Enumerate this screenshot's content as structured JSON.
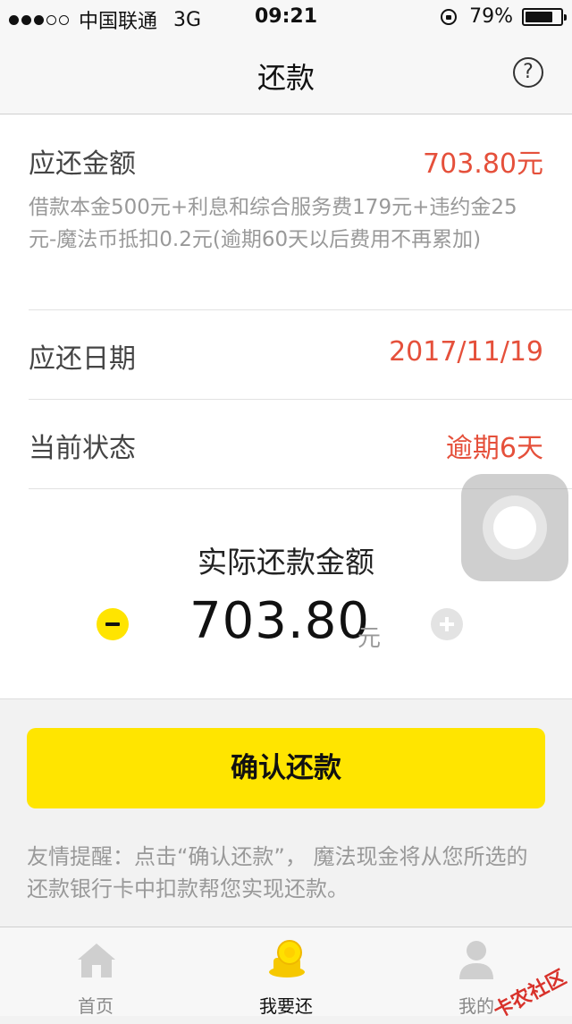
{
  "status_bar": {
    "carrier": "中国联通",
    "network": "3G",
    "time": "09:21",
    "battery_percent": "79%",
    "signal_bars_filled": 3,
    "signal_bars_total": 5
  },
  "nav": {
    "title": "还款",
    "help_icon": "?"
  },
  "repayment": {
    "amount_due_label": "应还金额",
    "amount_due_value": "703.80元",
    "amount_detail": "借款本金500元+利息和综合服务费179元+违约金25元-魔法币抵扣0.2元(逾期60天以后费用不再累加)",
    "due_date_label": "应还日期",
    "due_date_value": "2017/11/19",
    "status_label": "当前状态",
    "status_value": "逾期6天",
    "actual_amount_title": "实际还款金额",
    "actual_amount": "703.80",
    "currency_unit": "元"
  },
  "confirm_button": "确认还款",
  "reminder": "友情提醒：点击“确认还款”， 魔法现金将从您所选的还款银行卡中扣款帮您实现还款。",
  "tabs": [
    {
      "label": "首页",
      "icon": "home-icon",
      "active": false
    },
    {
      "label": "我要还",
      "icon": "coin-icon",
      "active": true
    },
    {
      "label": "我的",
      "icon": "user-icon",
      "active": false
    }
  ],
  "watermark": "卡农社区",
  "colors": {
    "accent_yellow": "#ffe500",
    "overdue_red": "#e5503b"
  }
}
